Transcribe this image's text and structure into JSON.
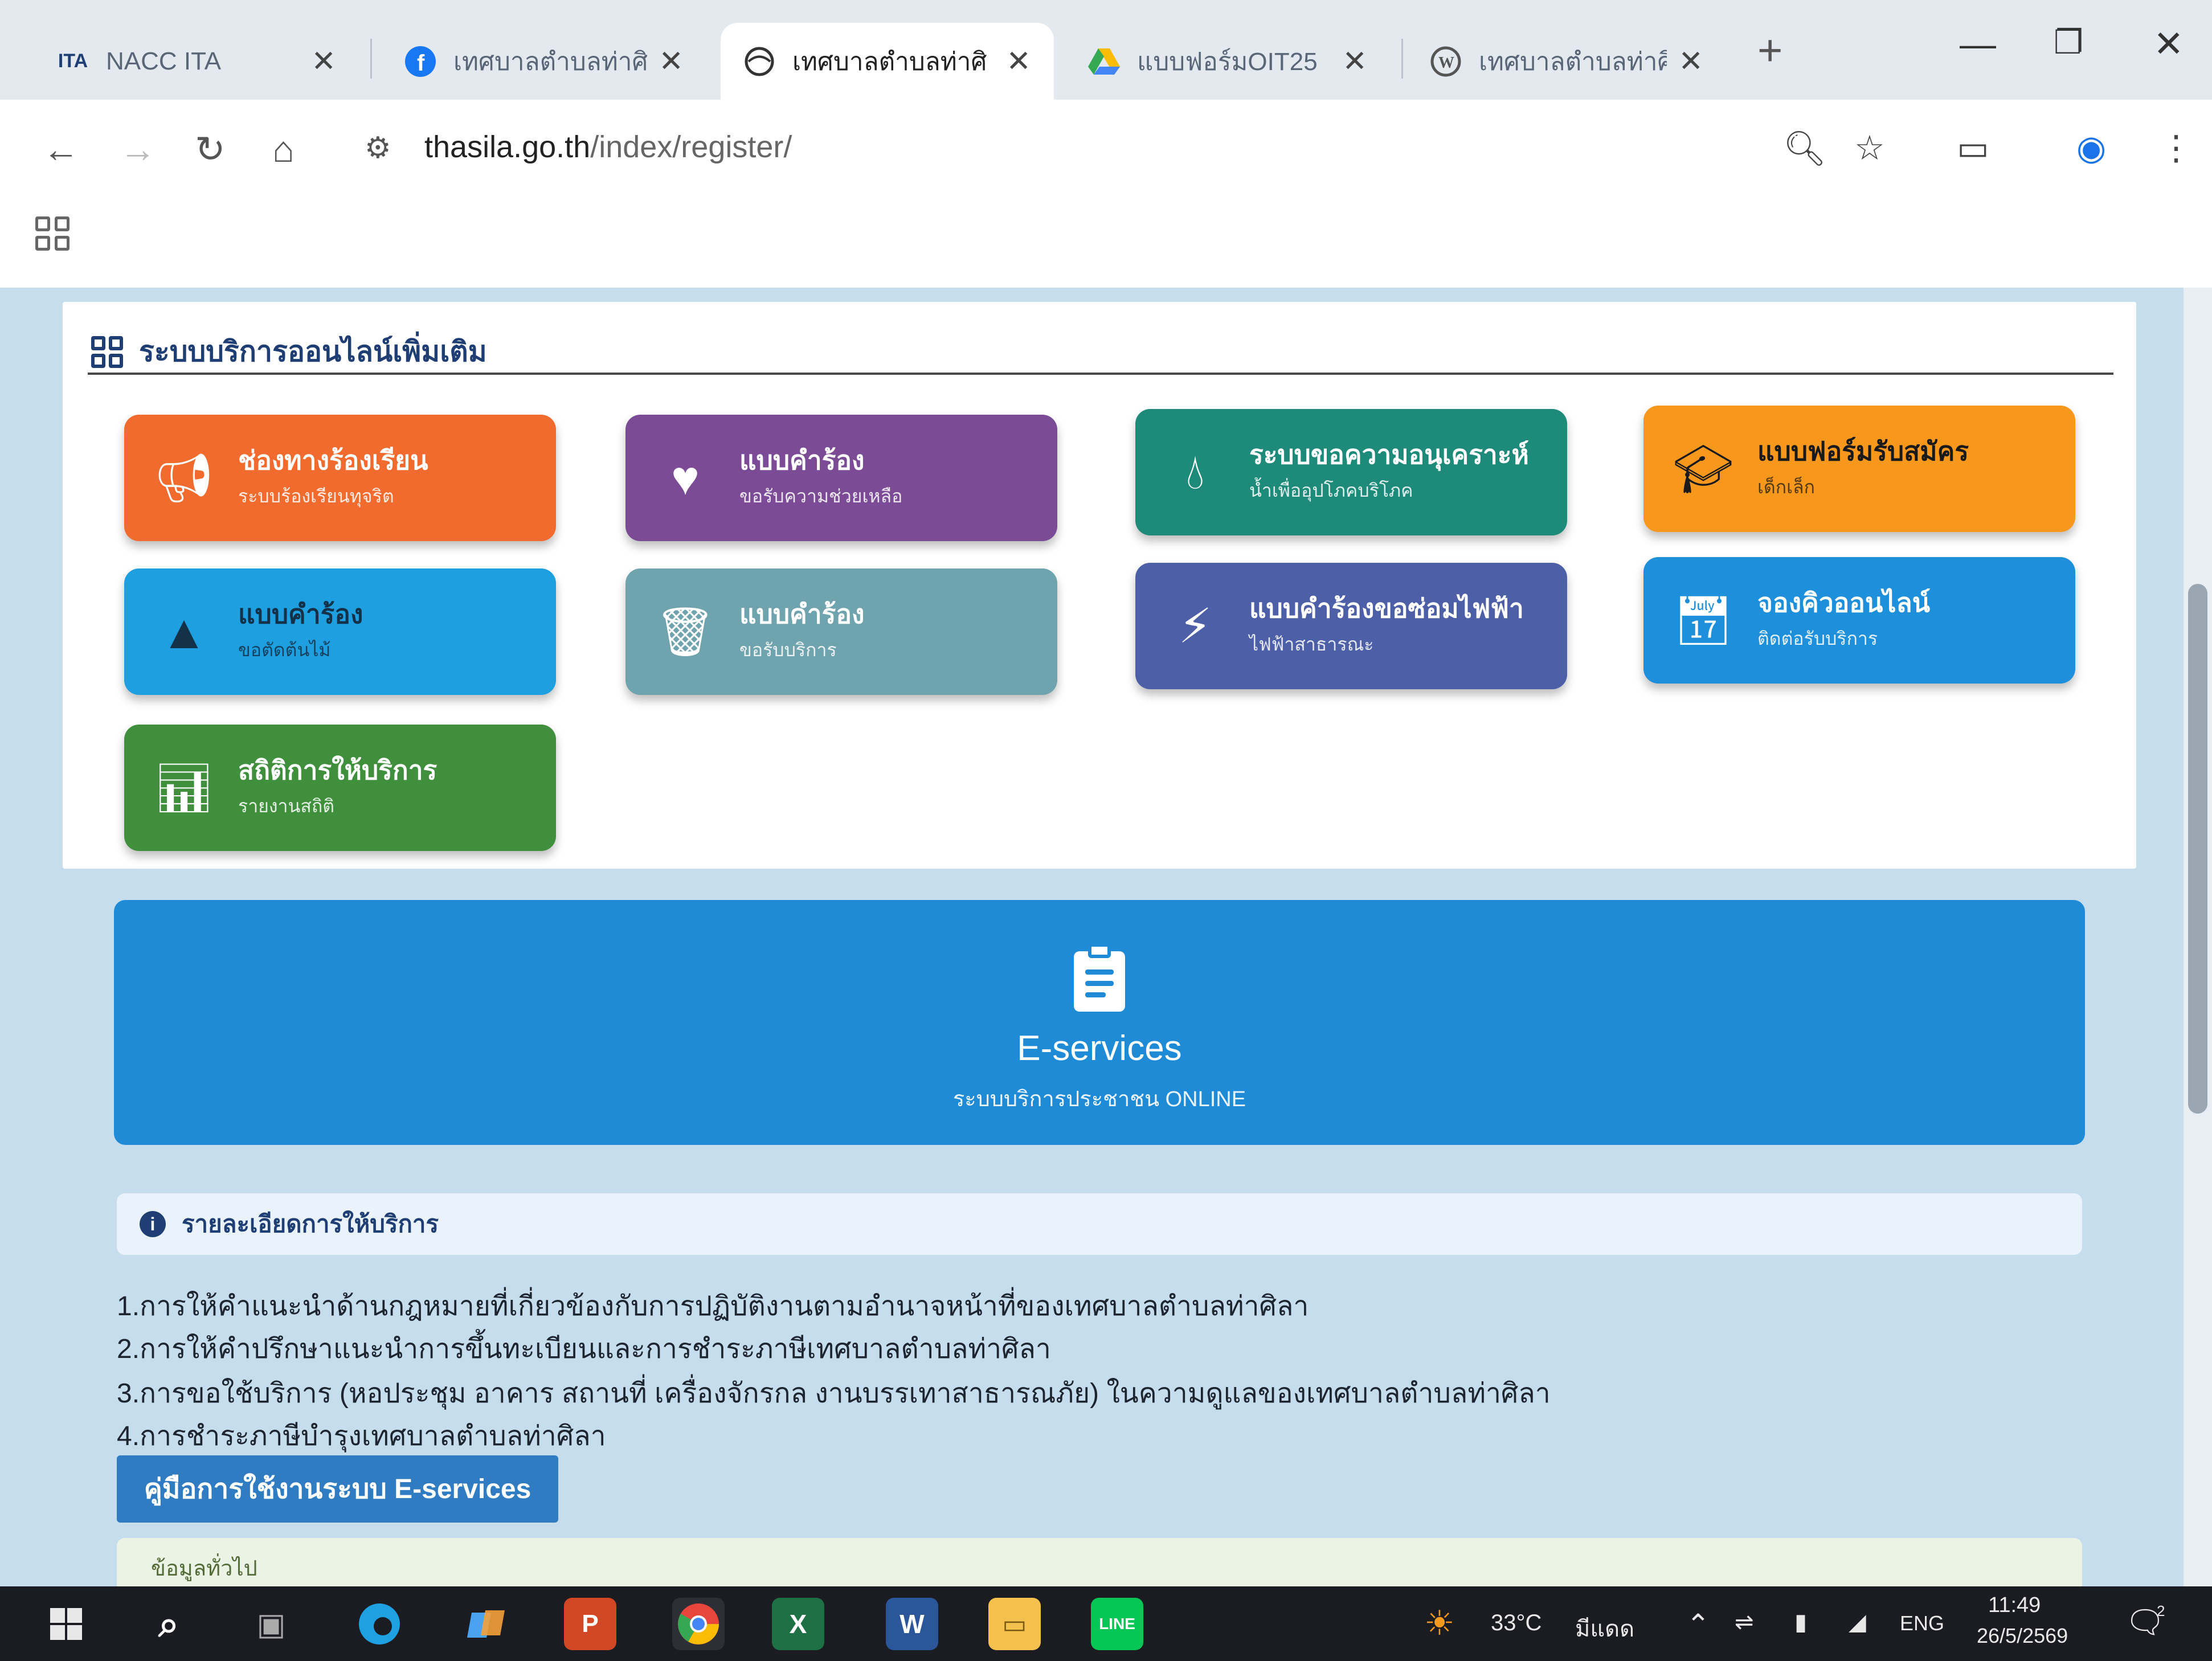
{
  "browser": {
    "tabs": [
      {
        "title": "NACC ITA",
        "favicon": "nacc-logo-icon",
        "active": false
      },
      {
        "title": "เทศบาลตำบลท่าศิ",
        "favicon": "facebook-icon",
        "active": false
      },
      {
        "title": "เทศบาลตำบลท่าศิ",
        "favicon": "globe-icon",
        "active": true
      },
      {
        "title": "แบบฟอร์มOIT25",
        "favicon": "google-drive-icon",
        "active": false
      },
      {
        "title": "เทศบาลตำบลท่าศิ",
        "favicon": "wordpress-icon",
        "active": false
      }
    ],
    "url_domain": "thasila.go.th",
    "url_path": "/index/register/"
  },
  "services": {
    "heading": "ระบบบริการออนไลน์เพิ่มเติม",
    "buttons": [
      {
        "title": "ช่องทางร้องเรียน",
        "subtitle": "ระบบร้องเรียนทุจริต",
        "icon": "megaphone-icon",
        "color": "#f26b2e"
      },
      {
        "title": "แบบคำร้อง",
        "subtitle": "ขอรับความช่วยเหลือ",
        "icon": "hand-heart-icon",
        "color": "#7b4c95"
      },
      {
        "title": "ระบบขอความอนุเคราะห์",
        "subtitle": "น้ำเพื่ออุปโภคบริโภค",
        "icon": "water-drop-icon",
        "color": "#1d8a7a"
      },
      {
        "title": "แบบฟอร์มรับสมัคร",
        "subtitle": "เด็กเล็ก",
        "icon": "graduation-cap-icon",
        "color": "#f7971c"
      },
      {
        "title": "แบบคำร้อง",
        "subtitle": "ขอตัดต้นไม้",
        "icon": "tree-icon",
        "color": "#1e9fe0"
      },
      {
        "title": "แบบคำร้อง",
        "subtitle": "ขอรับบริการ",
        "icon": "trash-bin-icon",
        "color": "#6fa3ad"
      },
      {
        "title": "แบบคำร้องขอซ่อมไฟฟ้า",
        "subtitle": "ไฟฟ้าสาธารณะ",
        "icon": "lightning-icon",
        "color": "#4d5fa6"
      },
      {
        "title": "จองคิวออนไลน์",
        "subtitle": "ติดต่อรับบริการ",
        "icon": "calendar-check-icon",
        "color": "#1e8fdb"
      },
      {
        "title": "สถิติการให้บริการ",
        "subtitle": "รายงานสถิติ",
        "icon": "bar-chart-icon",
        "color": "#3f8f3d"
      }
    ]
  },
  "eservices": {
    "title": "E-services",
    "subtitle": "ระบบบริการประชาชน ONLINE"
  },
  "details": {
    "heading": "รายละเอียดการให้บริการ",
    "items": [
      "1.การให้คำแนะนำด้านกฎหมายที่เกี่ยวข้องกับการปฏิบัติงานตามอำนาจหน้าที่ของเทศบาลตำบลท่าศิลา",
      "2.การให้คำปรึกษาแนะนำการขึ้นทะเบียนและการชำระภาษีเทศบาลตำบลท่าศิลา",
      "3.การขอใช้บริการ (หอประชุม อาคาร สถานที่ เครื่องจักรกล งานบรรเทาสาธารณภัย) ในความดูแลของเทศบาลตำบลท่าศิลา",
      "4.การชำระภาษีบำรุงเทศบาลตำบลท่าศิลา"
    ],
    "manual_button": "คู่มือการใช้งานระบบ E-services",
    "next_section": "ข้อมูลทั่วไป"
  },
  "taskbar": {
    "weather_temp": "33°C",
    "weather_text": "มีแดด",
    "language": "ENG",
    "time": "11:49",
    "date": "26/5/2569",
    "notification_badge": "2"
  }
}
